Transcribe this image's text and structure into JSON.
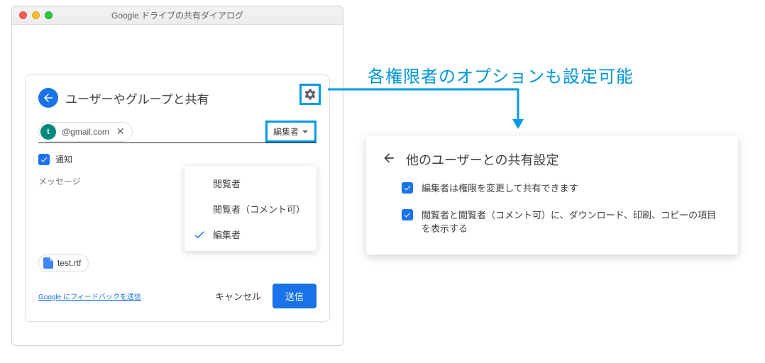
{
  "window": {
    "title": "Google ドライブの共有ダイアログ"
  },
  "dialog": {
    "title": "ユーザーやグループと共有",
    "chip": {
      "avatar_initial": "t",
      "email": "@gmail.com"
    },
    "role_button_label": "編集者",
    "notify_label": "通知",
    "message_label": "メッセージ",
    "role_menu": {
      "viewer": "閲覧者",
      "commenter": "閲覧者（コメント可）",
      "editor": "編集者"
    },
    "file_name": "test.rtf",
    "feedback": "Google にフィードバックを送信",
    "cancel": "キャンセル",
    "send": "送信"
  },
  "annotation": {
    "title": "各権限者のオプションも設定可能"
  },
  "settings_panel": {
    "title": "他のユーザーとの共有設定",
    "opt1": "編集者は権限を変更して共有できます",
    "opt2": "閲覧者と閲覧者（コメント可）に、ダウンロード、印刷、コピーの項目を表示する"
  }
}
